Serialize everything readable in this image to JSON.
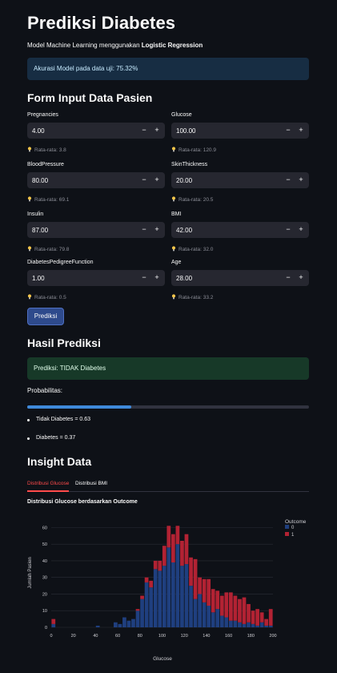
{
  "header": {
    "title": "Prediksi Diabetes",
    "subtitle_prefix": "Model Machine Learning menggunakan ",
    "subtitle_model": "Logistic Regression"
  },
  "accuracy": {
    "label": "Akurasi Model pada data uji: ",
    "value": "75.32%"
  },
  "form": {
    "heading": "Form Input Data Pasien",
    "fields": [
      {
        "label": "Pregnancies",
        "value": "4.00",
        "hint": "Rata-rata: 3.8"
      },
      {
        "label": "Glucose",
        "value": "100.00",
        "hint": "Rata-rata: 120.9"
      },
      {
        "label": "BloodPressure",
        "value": "80.00",
        "hint": "Rata-rata: 69.1"
      },
      {
        "label": "SkinThickness",
        "value": "20.00",
        "hint": "Rata-rata: 20.5"
      },
      {
        "label": "Insulin",
        "value": "87.00",
        "hint": "Rata-rata: 79.8"
      },
      {
        "label": "BMI",
        "value": "42.00",
        "hint": "Rata-rata: 32.0"
      },
      {
        "label": "DiabetesPedigreeFunction",
        "value": "1.00",
        "hint": "Rata-rata: 0.5"
      },
      {
        "label": "Age",
        "value": "28.00",
        "hint": "Rata-rata: 33.2"
      }
    ],
    "minus": "−",
    "plus": "+",
    "submit_label": "Prediksi"
  },
  "result": {
    "heading": "Hasil Prediksi",
    "prediction": "Prediksi: TIDAK Diabetes",
    "prob_label": "Probabilitas:",
    "progress": 0.37,
    "items": [
      "Tidak Diabetes = 0.63",
      "Diabetes = 0.37"
    ]
  },
  "insight": {
    "heading": "Insight Data",
    "tabs": [
      "Distribusi Glucose",
      "Distribusi BMI"
    ],
    "active_tab": 0,
    "active_color": "#ff4b4b"
  },
  "chart_data": {
    "type": "bar",
    "stacked": true,
    "title": "Distribusi Glucose berdasarkan Outcome",
    "xlabel": "Glucose",
    "ylabel": "Jumlah Pasien",
    "xlim": [
      0,
      200
    ],
    "ylim": [
      0,
      65
    ],
    "xticks": [
      0,
      20,
      40,
      60,
      80,
      100,
      120,
      140,
      160,
      180,
      200
    ],
    "yticks": [
      0,
      10,
      20,
      30,
      40,
      50,
      60
    ],
    "bin_width": 4,
    "x": [
      0,
      40,
      56,
      60,
      64,
      68,
      72,
      76,
      80,
      84,
      88,
      92,
      96,
      100,
      104,
      108,
      112,
      116,
      120,
      124,
      128,
      132,
      136,
      140,
      144,
      148,
      152,
      156,
      160,
      164,
      168,
      172,
      176,
      180,
      184,
      188,
      192,
      196
    ],
    "legend_title": "Outcome",
    "legend_position": "top-right",
    "series": [
      {
        "name": "0",
        "color": "#1f3f7f",
        "values": [
          2,
          1,
          3,
          2,
          6,
          4,
          5,
          10,
          17,
          27,
          24,
          35,
          34,
          37,
          48,
          39,
          50,
          37,
          38,
          25,
          17,
          20,
          15,
          13,
          9,
          11,
          7,
          6,
          4,
          4,
          3,
          2,
          3,
          2,
          1,
          3,
          1,
          1
        ]
      },
      {
        "name": "1",
        "color": "#b22233",
        "values": [
          3,
          0,
          0,
          0,
          0,
          0,
          0,
          1,
          2,
          3,
          4,
          5,
          6,
          12,
          13,
          17,
          11,
          15,
          18,
          17,
          24,
          10,
          14,
          16,
          14,
          11,
          12,
          15,
          17,
          15,
          14,
          16,
          11,
          8,
          10,
          6,
          4,
          10
        ]
      }
    ]
  }
}
